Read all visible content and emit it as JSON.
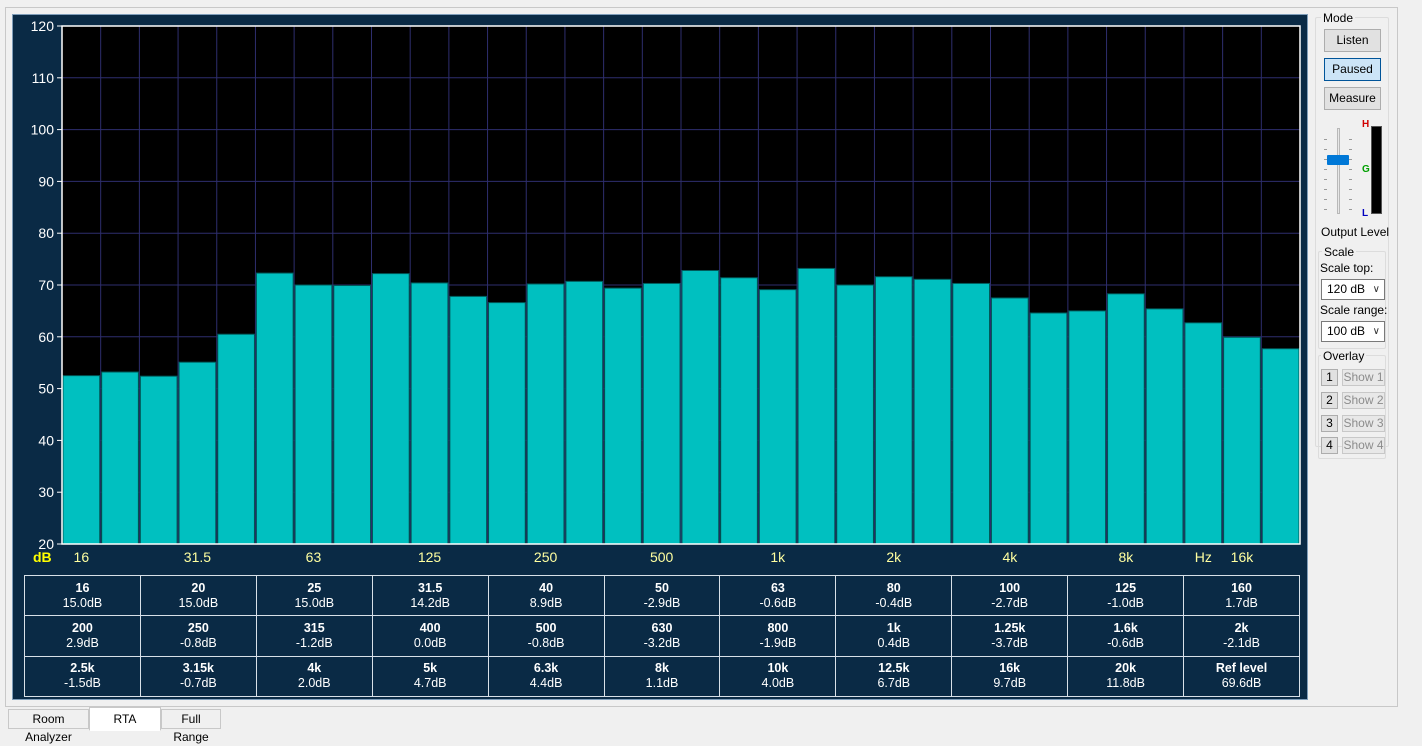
{
  "chart_data": {
    "type": "bar",
    "y_unit_label": "dB",
    "ylim": [
      20,
      120
    ],
    "y_ticks": [
      20,
      30,
      40,
      50,
      60,
      70,
      80,
      90,
      100,
      110,
      120
    ],
    "x_tick_labels": [
      "16",
      "31.5",
      "63",
      "125",
      "250",
      "500",
      "1k",
      "2k",
      "4k",
      "8k",
      "16k"
    ],
    "x_unit_label": "Hz",
    "categories": [
      "16",
      "20",
      "25",
      "31.5",
      "40",
      "50",
      "63",
      "80",
      "100",
      "125",
      "160",
      "200",
      "250",
      "315",
      "400",
      "500",
      "630",
      "800",
      "1k",
      "1.25k",
      "1.6k",
      "2k",
      "2.5k",
      "3.15k",
      "4k",
      "5k",
      "6.3k",
      "8k",
      "10k",
      "12.5k",
      "16k",
      "20k"
    ],
    "values": [
      52.5,
      53.2,
      52.4,
      55.1,
      60.5,
      72.3,
      70.0,
      69.9,
      72.2,
      70.4,
      67.8,
      66.6,
      70.2,
      70.7,
      69.4,
      70.3,
      72.8,
      71.4,
      69.1,
      73.2,
      70.0,
      71.6,
      71.1,
      70.3,
      67.5,
      64.6,
      65.0,
      68.3,
      65.4,
      62.7,
      59.9,
      57.7
    ],
    "grid": true,
    "colors": {
      "bar": "#00c0c0",
      "bar_edge": "#005a5a",
      "plot_bg": "#000000",
      "grid": "#2e2e6e",
      "panel_bg": "#0a2a45",
      "tick_x": "#ffffa0",
      "tick_y": "#ffffff",
      "db_label": "#ffff00"
    }
  },
  "band_table": {
    "rows": [
      [
        {
          "f": "16",
          "v": "15.0dB"
        },
        {
          "f": "20",
          "v": "15.0dB"
        },
        {
          "f": "25",
          "v": "15.0dB"
        },
        {
          "f": "31.5",
          "v": "14.2dB"
        },
        {
          "f": "40",
          "v": "8.9dB"
        },
        {
          "f": "50",
          "v": "-2.9dB"
        },
        {
          "f": "63",
          "v": "-0.6dB"
        },
        {
          "f": "80",
          "v": "-0.4dB"
        },
        {
          "f": "100",
          "v": "-2.7dB"
        },
        {
          "f": "125",
          "v": "-1.0dB"
        },
        {
          "f": "160",
          "v": "1.7dB"
        }
      ],
      [
        {
          "f": "200",
          "v": "2.9dB"
        },
        {
          "f": "250",
          "v": "-0.8dB"
        },
        {
          "f": "315",
          "v": "-1.2dB"
        },
        {
          "f": "400",
          "v": "0.0dB"
        },
        {
          "f": "500",
          "v": "-0.8dB"
        },
        {
          "f": "630",
          "v": "-3.2dB"
        },
        {
          "f": "800",
          "v": "-1.9dB"
        },
        {
          "f": "1k",
          "v": "0.4dB"
        },
        {
          "f": "1.25k",
          "v": "-3.7dB"
        },
        {
          "f": "1.6k",
          "v": "-0.6dB"
        },
        {
          "f": "2k",
          "v": "-2.1dB"
        }
      ],
      [
        {
          "f": "2.5k",
          "v": "-1.5dB"
        },
        {
          "f": "3.15k",
          "v": "-0.7dB"
        },
        {
          "f": "4k",
          "v": "2.0dB"
        },
        {
          "f": "5k",
          "v": "4.7dB"
        },
        {
          "f": "6.3k",
          "v": "4.4dB"
        },
        {
          "f": "8k",
          "v": "1.1dB"
        },
        {
          "f": "10k",
          "v": "4.0dB"
        },
        {
          "f": "12.5k",
          "v": "6.7dB"
        },
        {
          "f": "16k",
          "v": "9.7dB"
        },
        {
          "f": "20k",
          "v": "11.8dB"
        },
        {
          "f": "Ref level",
          "v": "69.6dB"
        }
      ]
    ]
  },
  "controls": {
    "mode": {
      "title": "Mode",
      "listen": "Listen",
      "paused": "Paused",
      "measure": "Measure",
      "active": "Paused"
    },
    "output_level": {
      "label": "Output Level",
      "meter_h": "H",
      "meter_g": "G",
      "meter_l": "L",
      "slider_fraction": 0.35
    },
    "scale": {
      "title": "Scale",
      "top_label": "Scale top:",
      "top_value": "120 dB",
      "range_label": "Scale range:",
      "range_value": "100 dB"
    },
    "overlay": {
      "title": "Overlay",
      "items": [
        {
          "num": "1",
          "show": "Show 1"
        },
        {
          "num": "2",
          "show": "Show 2"
        },
        {
          "num": "3",
          "show": "Show 3"
        },
        {
          "num": "4",
          "show": "Show 4"
        }
      ]
    }
  },
  "tabs": [
    "Room Analyzer",
    "RTA",
    "Full Range"
  ],
  "selected_tab": "RTA"
}
